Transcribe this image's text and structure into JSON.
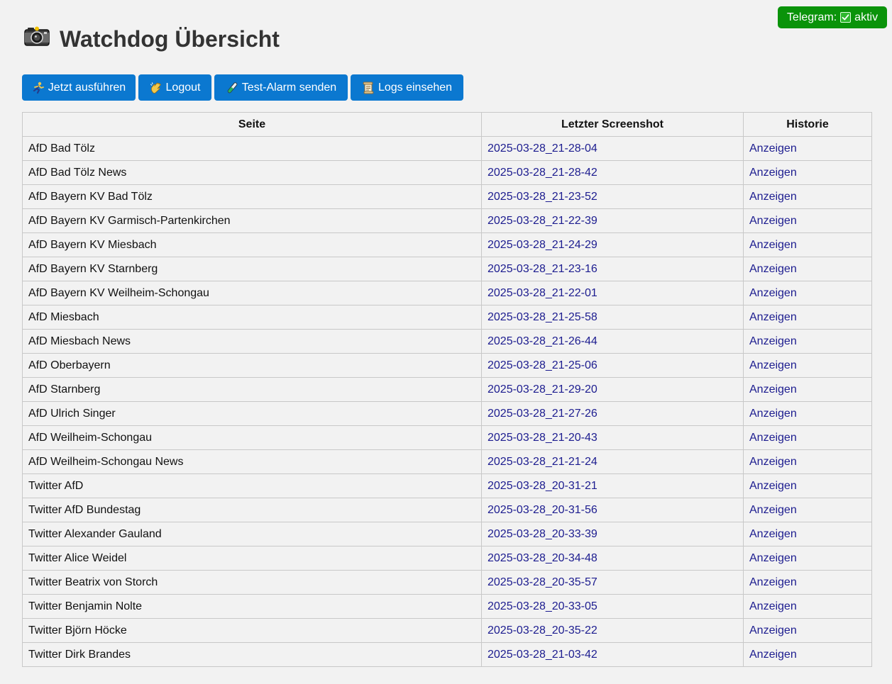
{
  "telegram": {
    "label": "Telegram:",
    "status": "aktiv",
    "color": "#0a930a"
  },
  "header": {
    "title": "Watchdog Übersicht",
    "icon": "camera-icon"
  },
  "toolbar": {
    "run_label": "Jetzt ausführen",
    "logout_label": "Logout",
    "test_alarm_label": "Test-Alarm senden",
    "logs_label": "Logs einsehen"
  },
  "accent_color": "#0b78d0",
  "table": {
    "headers": {
      "site": "Seite",
      "screenshot": "Letzter Screenshot",
      "history": "Historie"
    },
    "rows": [
      {
        "site": "AfD Bad Tölz",
        "screenshot": "2025-03-28_21-28-04",
        "history": "Anzeigen"
      },
      {
        "site": "AfD Bad Tölz News",
        "screenshot": "2025-03-28_21-28-42",
        "history": "Anzeigen"
      },
      {
        "site": "AfD Bayern KV Bad Tölz",
        "screenshot": "2025-03-28_21-23-52",
        "history": "Anzeigen"
      },
      {
        "site": "AfD Bayern KV Garmisch-Partenkirchen",
        "screenshot": "2025-03-28_21-22-39",
        "history": "Anzeigen"
      },
      {
        "site": "AfD Bayern KV Miesbach",
        "screenshot": "2025-03-28_21-24-29",
        "history": "Anzeigen"
      },
      {
        "site": "AfD Bayern KV Starnberg",
        "screenshot": "2025-03-28_21-23-16",
        "history": "Anzeigen"
      },
      {
        "site": "AfD Bayern KV Weilheim-Schongau",
        "screenshot": "2025-03-28_21-22-01",
        "history": "Anzeigen"
      },
      {
        "site": "AfD Miesbach",
        "screenshot": "2025-03-28_21-25-58",
        "history": "Anzeigen"
      },
      {
        "site": "AfD Miesbach News",
        "screenshot": "2025-03-28_21-26-44",
        "history": "Anzeigen"
      },
      {
        "site": "AfD Oberbayern",
        "screenshot": "2025-03-28_21-25-06",
        "history": "Anzeigen"
      },
      {
        "site": "AfD Starnberg",
        "screenshot": "2025-03-28_21-29-20",
        "history": "Anzeigen"
      },
      {
        "site": "AfD Ulrich Singer",
        "screenshot": "2025-03-28_21-27-26",
        "history": "Anzeigen"
      },
      {
        "site": "AfD Weilheim-Schongau",
        "screenshot": "2025-03-28_21-20-43",
        "history": "Anzeigen"
      },
      {
        "site": "AfD Weilheim-Schongau News",
        "screenshot": "2025-03-28_21-21-24",
        "history": "Anzeigen"
      },
      {
        "site": "Twitter AfD",
        "screenshot": "2025-03-28_20-31-21",
        "history": "Anzeigen"
      },
      {
        "site": "Twitter AfD Bundestag",
        "screenshot": "2025-03-28_20-31-56",
        "history": "Anzeigen"
      },
      {
        "site": "Twitter Alexander Gauland",
        "screenshot": "2025-03-28_20-33-39",
        "history": "Anzeigen"
      },
      {
        "site": "Twitter Alice Weidel",
        "screenshot": "2025-03-28_20-34-48",
        "history": "Anzeigen"
      },
      {
        "site": "Twitter Beatrix von Storch",
        "screenshot": "2025-03-28_20-35-57",
        "history": "Anzeigen"
      },
      {
        "site": "Twitter Benjamin Nolte",
        "screenshot": "2025-03-28_20-33-05",
        "history": "Anzeigen"
      },
      {
        "site": "Twitter Björn Höcke",
        "screenshot": "2025-03-28_20-35-22",
        "history": "Anzeigen"
      },
      {
        "site": "Twitter Dirk Brandes",
        "screenshot": "2025-03-28_21-03-42",
        "history": "Anzeigen"
      }
    ]
  }
}
